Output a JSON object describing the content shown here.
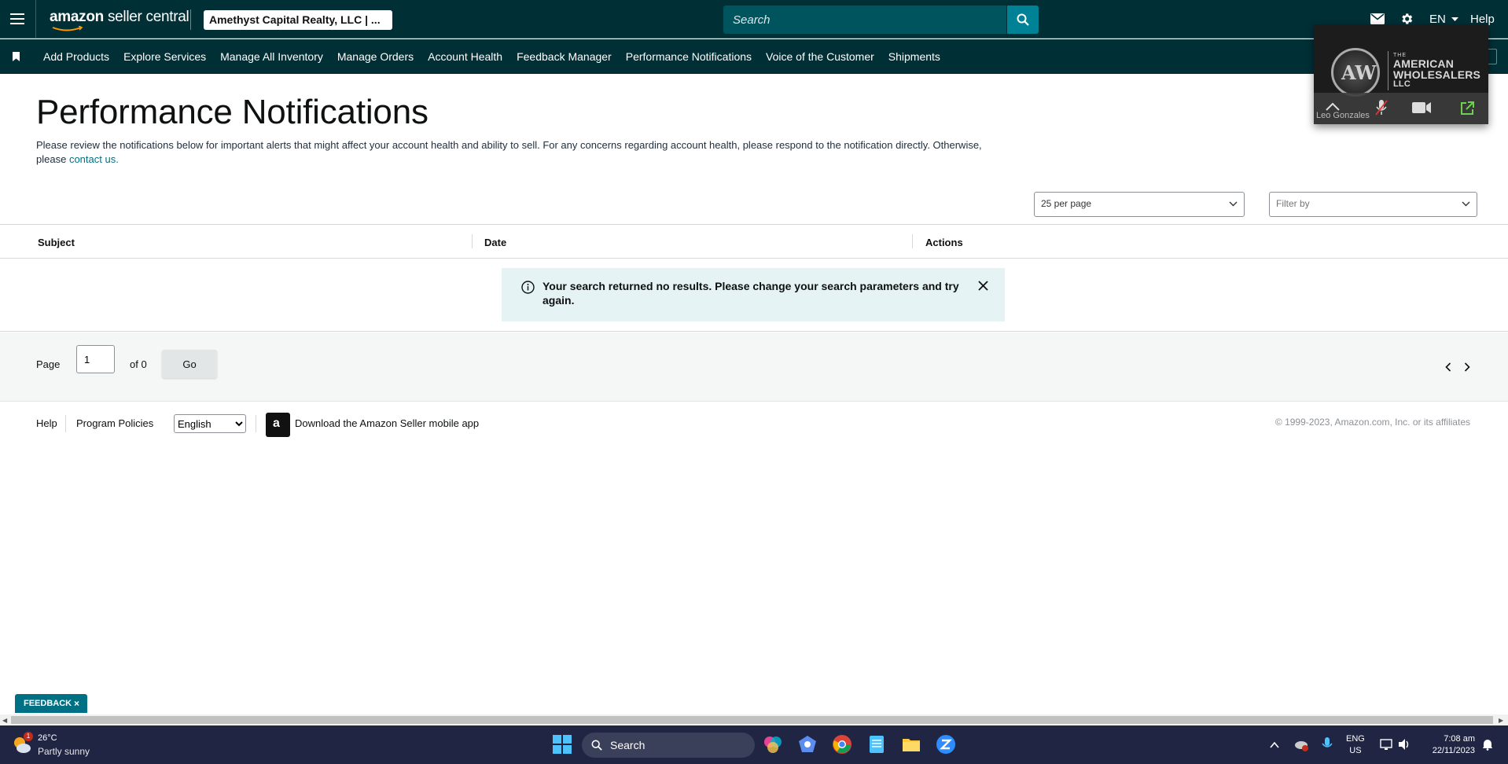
{
  "header": {
    "logo_main": "amazon",
    "logo_sub": "seller central",
    "account": "Amethyst Capital Realty, LLC | ...",
    "search_placeholder": "Search",
    "language": "EN",
    "help": "Help"
  },
  "nav": {
    "items": [
      {
        "label": "Add Products"
      },
      {
        "label": "Explore Services"
      },
      {
        "label": "Manage All Inventory"
      },
      {
        "label": "Manage Orders"
      },
      {
        "label": "Account Health"
      },
      {
        "label": "Feedback Manager"
      },
      {
        "label": "Performance Notifications"
      },
      {
        "label": "Voice of the Customer"
      },
      {
        "label": "Shipments"
      }
    ]
  },
  "video_call": {
    "brand_small": "THE",
    "brand_line1": "AMERICAN",
    "brand_line2": "WHOLESALERS",
    "brand_line3": "LLC",
    "logo_letters": "AW",
    "participant": "Leo Gonzales"
  },
  "page": {
    "title": "Performance Notifications",
    "description": "Please review the notifications below for important alerts that might affect your account health and ability to sell. For any concerns regarding account health, please respond to the notification directly. Otherwise, please",
    "contact_link": "contact us.",
    "per_page": "25 per page",
    "filter_placeholder": "Filter by"
  },
  "table": {
    "columns": [
      "Subject",
      "Date",
      "Actions"
    ],
    "empty_message": "Your search returned no results. Please change your search parameters and try again."
  },
  "pagination": {
    "label": "Page",
    "current": "1",
    "of_text": "of 0",
    "go_label": "Go"
  },
  "footer": {
    "help": "Help",
    "policies": "Program Policies",
    "language": "English",
    "app_text": "Download the Amazon Seller mobile app",
    "copyright": "© 1999-2023, Amazon.com, Inc. or its affiliates"
  },
  "feedback": {
    "label": "FEEDBACK",
    "close": "×"
  },
  "taskbar": {
    "temperature": "26°C",
    "weather": "Partly sunny",
    "weather_badge": "1",
    "search": "Search",
    "lang_top": "ENG",
    "lang_bottom": "US",
    "time": "7:08 am",
    "date": "22/11/2023"
  },
  "colors": {
    "header_bg": "#002f36",
    "accent_teal": "#008296",
    "link": "#007185",
    "alert_bg": "#e6f3f5",
    "taskbar_bg": "#1f2542"
  }
}
